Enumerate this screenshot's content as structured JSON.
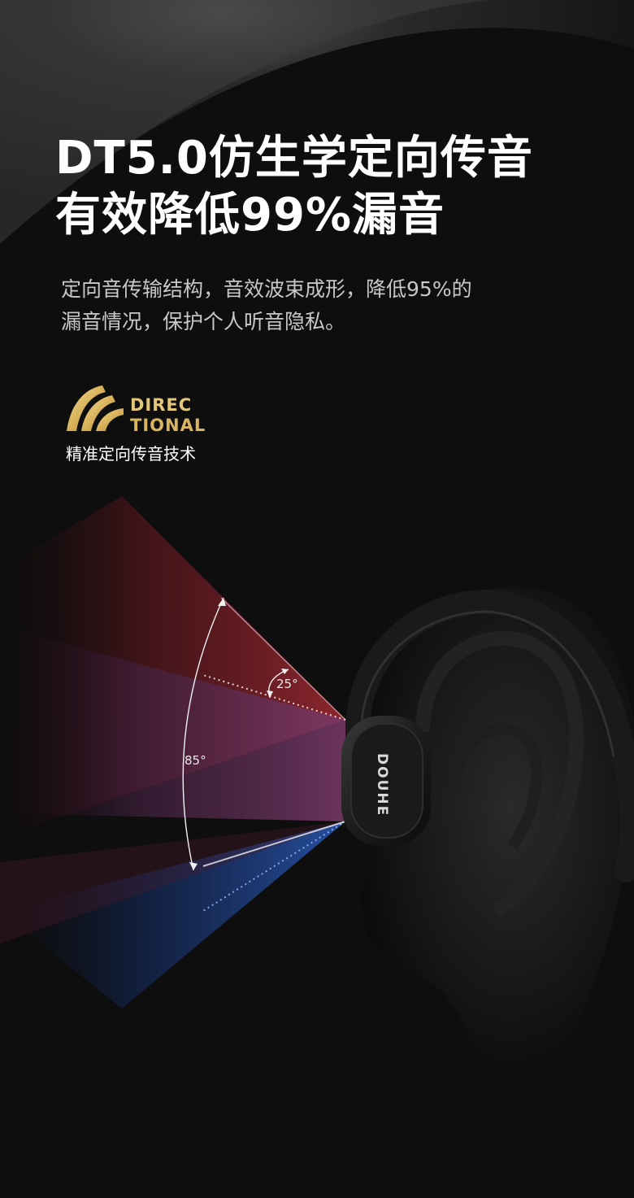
{
  "headline": {
    "line1": "DT5.0仿生学定向传音",
    "line2": "有效降低99%漏音"
  },
  "description": {
    "line1": "定向音传输结构，音效波束成形，降低95%的",
    "line2": "漏音情况，保护个人听音隐私。"
  },
  "logo": {
    "word_line1": "DIREC",
    "word_line2": "TIONAL",
    "caption": "精准定向传音技术"
  },
  "diagram": {
    "narrow_angle": "25°",
    "wide_angle": "85°"
  },
  "product": {
    "brand": "DOUHE"
  },
  "colors": {
    "gold": "#d9b560",
    "red_beam": "#8a1a24",
    "blue_beam": "#1c3f8f",
    "purple_beam": "#5b2a4e"
  }
}
